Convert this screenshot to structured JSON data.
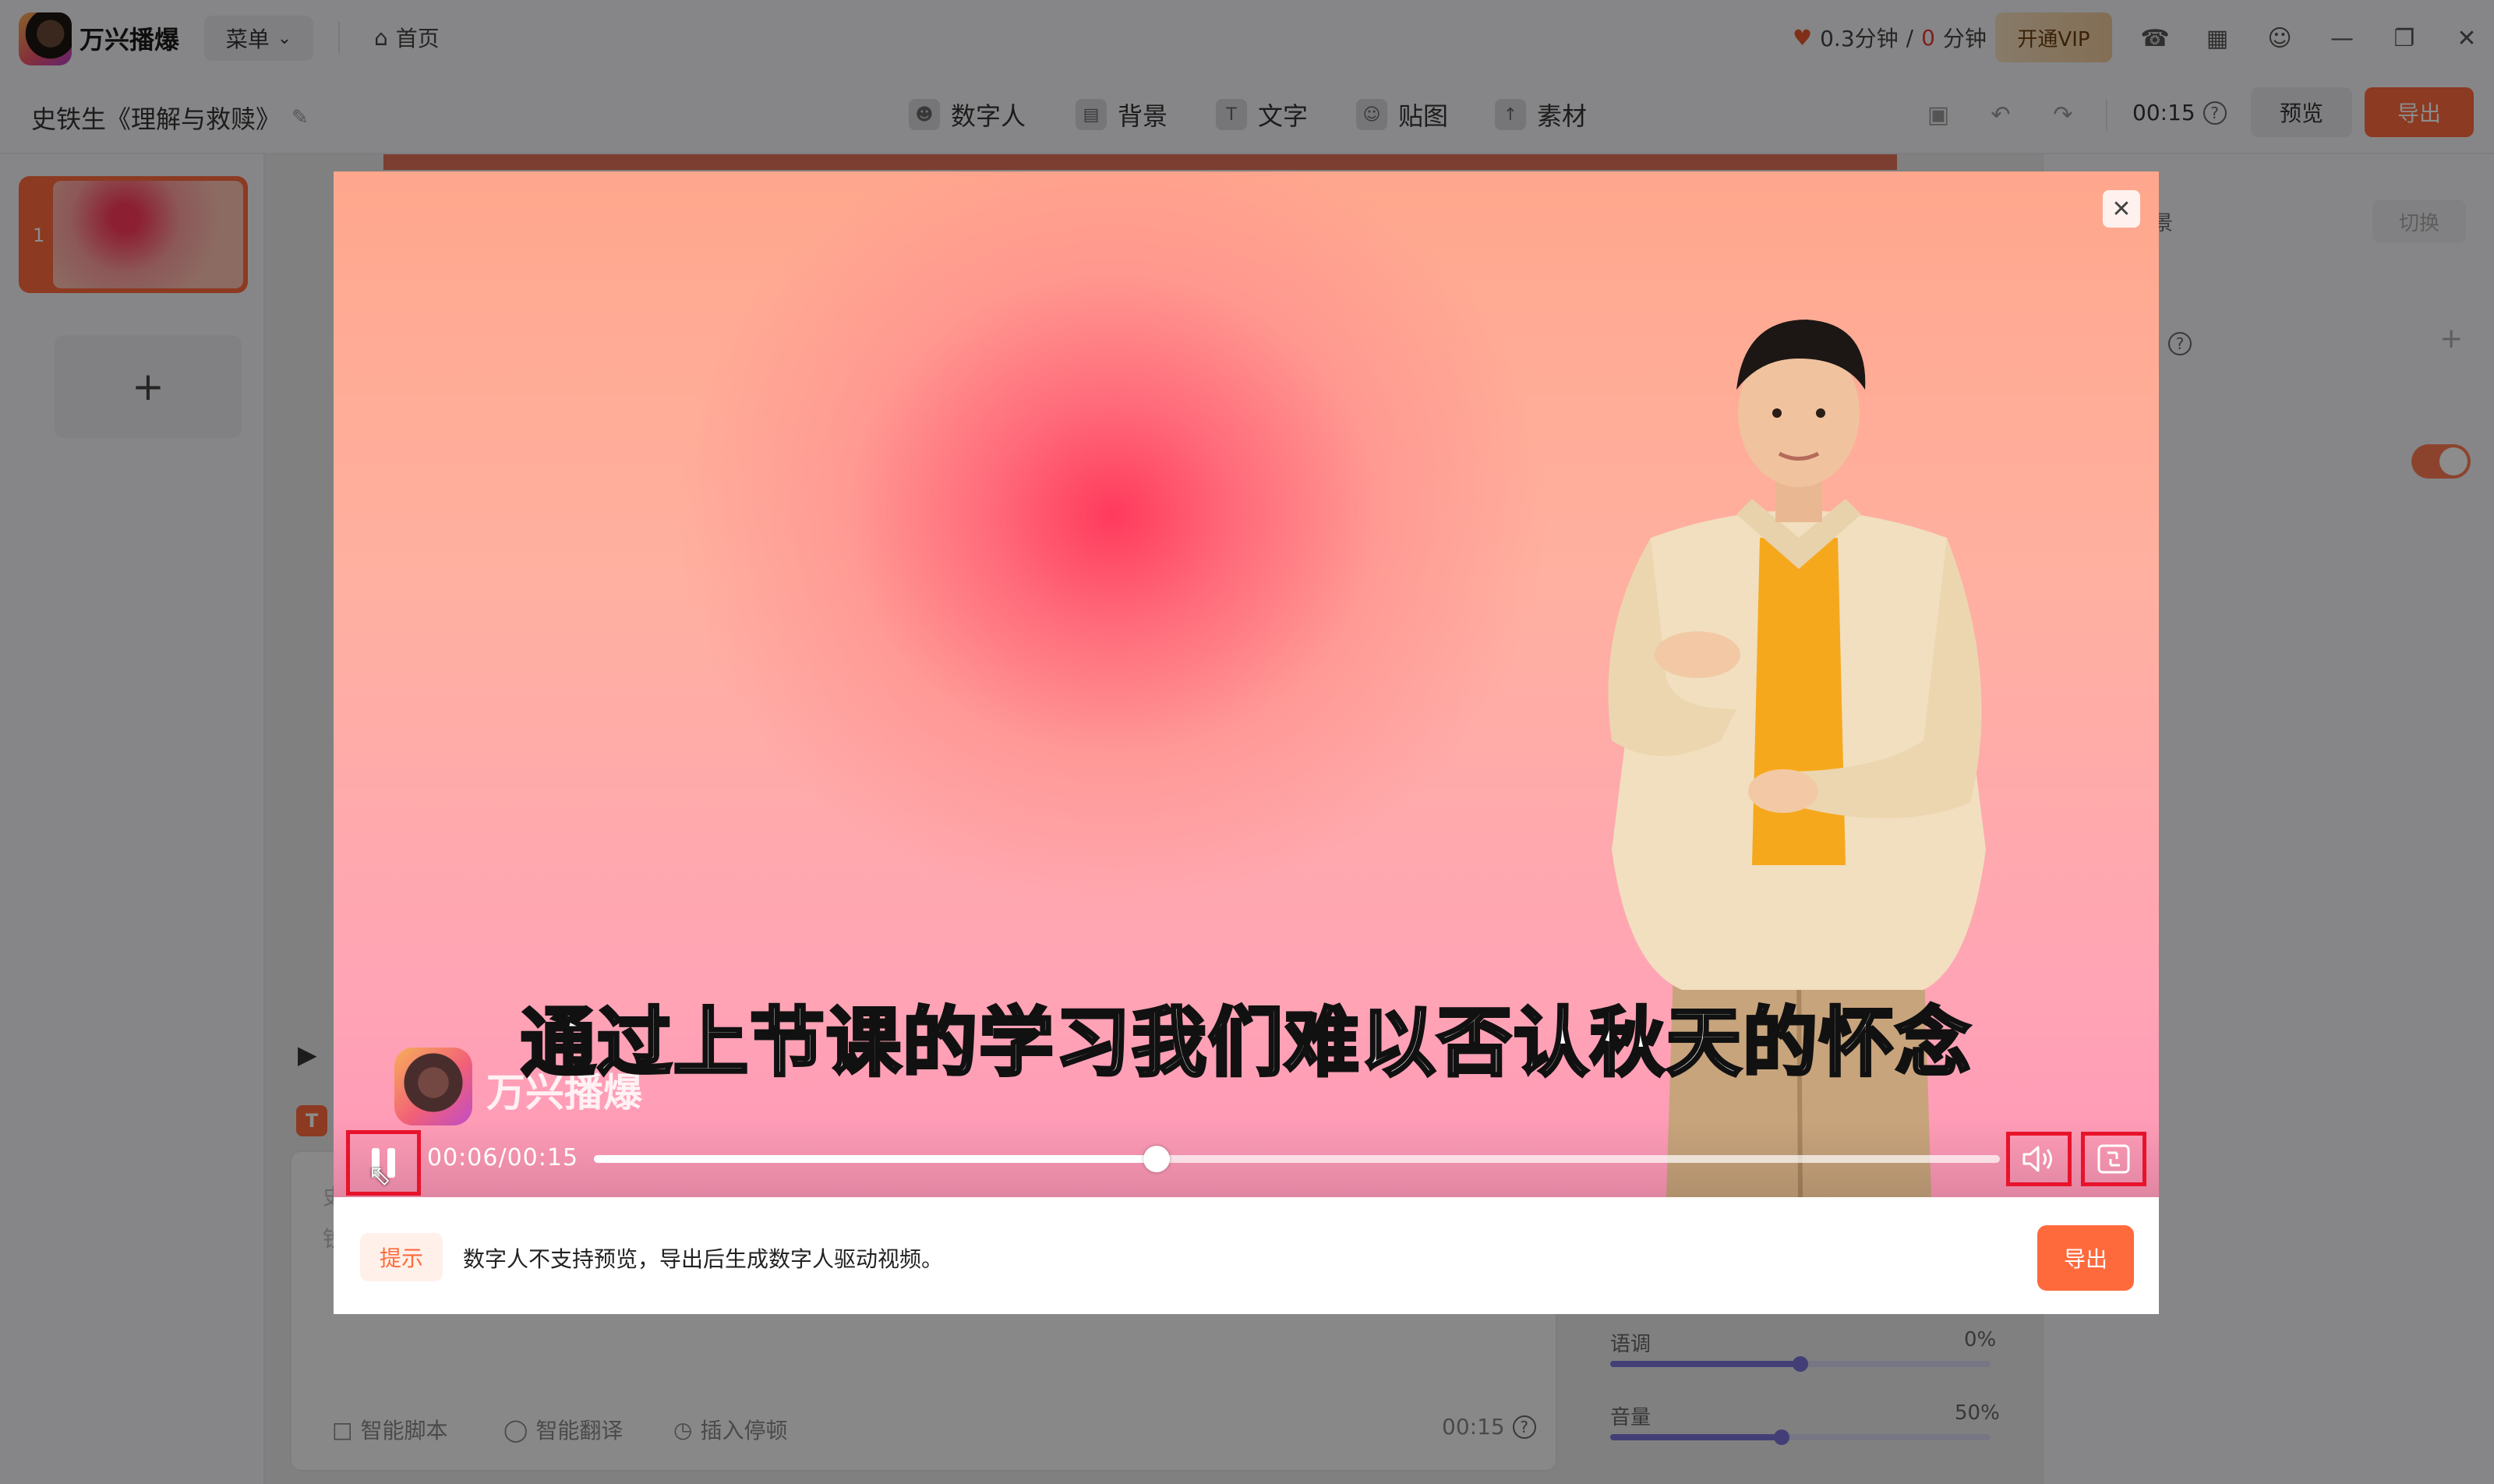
{
  "app": {
    "name": "万兴播爆",
    "menu_label": "菜单",
    "home_label": "首页",
    "quota_used": "0.3分钟",
    "quota_sep": "/",
    "quota_total_num": "0",
    "quota_total_unit": "分钟",
    "vip_label": "开通VIP"
  },
  "toolbar": {
    "project_title": "史铁生《理解与救赎》",
    "tools": [
      {
        "label": "数字人",
        "icon": "digital-human-icon"
      },
      {
        "label": "背景",
        "icon": "background-icon"
      },
      {
        "label": "文字",
        "icon": "text-icon"
      },
      {
        "label": "贴图",
        "icon": "sticker-icon"
      },
      {
        "label": "素材",
        "icon": "material-icon"
      }
    ],
    "duration": "00:15",
    "preview_label": "预览",
    "export_label": "导出"
  },
  "slides": {
    "items": [
      {
        "number": "1"
      }
    ],
    "add_label": "+"
  },
  "right_panel": {
    "bg_label": "景",
    "switch_label": "切换",
    "pitch_label": "语调",
    "pitch_value": "0%",
    "pitch_level": 0.5,
    "volume_label": "音量",
    "volume_value": "50%",
    "volume_level": 0.45
  },
  "script": {
    "smart_script": "智能脚本",
    "smart_translate": "智能翻译",
    "insert_pause": "插入停顿",
    "duration": "00:15",
    "side_text_1": "史",
    "side_text_2": "铁"
  },
  "modal": {
    "subtitle": "通过上节课的学习我们难以否认秋天的怀念",
    "watermark_text": "万兴播爆",
    "time_current": "00:06",
    "time_total": "00:15",
    "time_sep": "/",
    "progress": 0.4,
    "tip_tag": "提示",
    "tip_text": "数字人不支持预览，导出后生成数字人驱动视频。",
    "export_label": "导出"
  },
  "colors": {
    "accent": "#ff6a3d",
    "highlight": "#e8132b"
  }
}
